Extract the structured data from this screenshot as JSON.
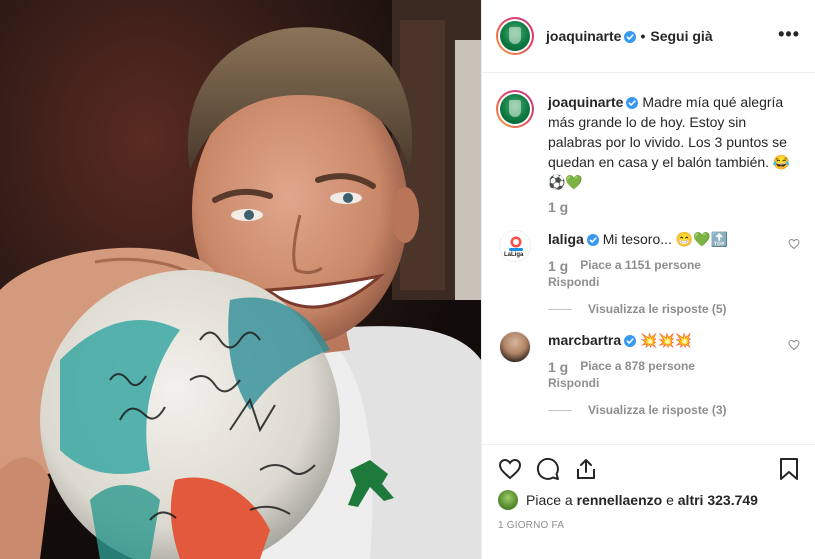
{
  "post": {
    "author": "joaquinarte",
    "follow_status": "Segui già",
    "more_label": "•••",
    "caption_user": "joaquinarte",
    "caption_text": "Madre mía qué alegría más grande lo de hoy. Estoy sin palabras por lo vivido. Los 3 puntos se quedan en casa y el balón también. 😂⚽💚",
    "caption_time": "1 g"
  },
  "comments": [
    {
      "user": "laliga",
      "text": "Mi tesoro... 😁💚🔝",
      "time": "1 g",
      "likes": "Piace a 1151 persone",
      "reply": "Rispondi",
      "view_replies": "Visualizza le risposte (5)",
      "avatar_label": "LaLiga"
    },
    {
      "user": "marcbartra",
      "text": "💥💥💥",
      "time": "1 g",
      "likes": "Piace a 878 persone",
      "reply": "Rispondi",
      "view_replies": "Visualizza le risposte (3)"
    }
  ],
  "footer": {
    "liked_prefix": "Piace a",
    "liked_user": "rennellaenzo",
    "liked_mid": "e",
    "liked_others": "altri 323.749",
    "date": "1 GIORNO FA"
  },
  "icons": {
    "like": "heart-outline",
    "comment": "speech-bubble",
    "share": "share-arrow",
    "save": "bookmark",
    "verified": "verified-badge",
    "more": "ellipsis"
  },
  "colors": {
    "verified": "#3897f0",
    "text": "#262626",
    "muted": "#8e8e8e",
    "divider": "#efefef",
    "ring_start": "#f9a13a",
    "ring_end": "#c13584"
  }
}
